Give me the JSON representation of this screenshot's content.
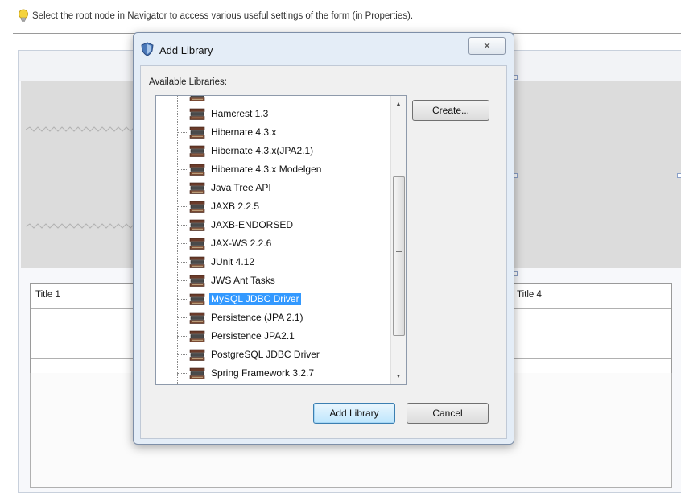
{
  "hint": {
    "text": "Select the root node in Navigator to access various useful settings of the form (in Properties)."
  },
  "background_table": {
    "col1": "Title 1",
    "col4": "Title 4"
  },
  "dialog": {
    "title": "Add Library",
    "close_glyph": "✕",
    "list_label": "Available Libraries:",
    "libraries": [
      {
        "label": "Hamcrest 1.3",
        "selected": false
      },
      {
        "label": "Hibernate 4.3.x",
        "selected": false
      },
      {
        "label": "Hibernate 4.3.x(JPA2.1)",
        "selected": false
      },
      {
        "label": "Hibernate 4.3.x Modelgen",
        "selected": false
      },
      {
        "label": "Java Tree API",
        "selected": false
      },
      {
        "label": "JAXB 2.2.5",
        "selected": false
      },
      {
        "label": "JAXB-ENDORSED",
        "selected": false
      },
      {
        "label": "JAX-WS 2.2.6",
        "selected": false
      },
      {
        "label": "JUnit 4.12",
        "selected": false
      },
      {
        "label": "JWS Ant Tasks",
        "selected": false
      },
      {
        "label": "MySQL JDBC Driver",
        "selected": true
      },
      {
        "label": "Persistence (JPA 2.1)",
        "selected": false
      },
      {
        "label": "Persistence JPA2.1",
        "selected": false
      },
      {
        "label": "PostgreSQL JDBC Driver",
        "selected": false
      },
      {
        "label": "Spring Framework 3.2.7",
        "selected": false
      }
    ],
    "create_button": "Create...",
    "add_button": "Add Library",
    "cancel_button": "Cancel"
  },
  "icons": {
    "hint": "lightbulb-icon",
    "dialog": "library-shield-icon",
    "item": "library-books-icon",
    "scroll_up": "arrow-up-icon",
    "scroll_down": "arrow-down-icon"
  },
  "colors": {
    "selection": "#3399ff",
    "dialog_frame": "#e4edf7",
    "primary_button": "#bee6fd"
  }
}
